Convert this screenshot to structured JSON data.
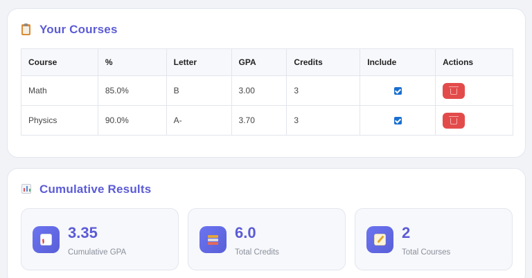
{
  "courses_section": {
    "title": "Your Courses",
    "columns": [
      "Course",
      "%",
      "Letter",
      "GPA",
      "Credits",
      "Include",
      "Actions"
    ],
    "rows": [
      {
        "course": "Math",
        "percent": "85.0%",
        "letter": "B",
        "gpa": "3.00",
        "credits": "3",
        "include": true
      },
      {
        "course": "Physics",
        "percent": "90.0%",
        "letter": "A-",
        "gpa": "3.70",
        "credits": "3",
        "include": true
      }
    ]
  },
  "results_section": {
    "title": "Cumulative Results",
    "stats": [
      {
        "value": "3.35",
        "label": "Cumulative GPA",
        "icon": "chart-increasing-icon"
      },
      {
        "value": "6.0",
        "label": "Total Credits",
        "icon": "books-icon"
      },
      {
        "value": "2",
        "label": "Total Courses",
        "icon": "memo-icon"
      }
    ]
  },
  "colors": {
    "accent": "#5b5bd6",
    "delete": "#e34b4b",
    "checkbox": "#1a6fd0"
  }
}
